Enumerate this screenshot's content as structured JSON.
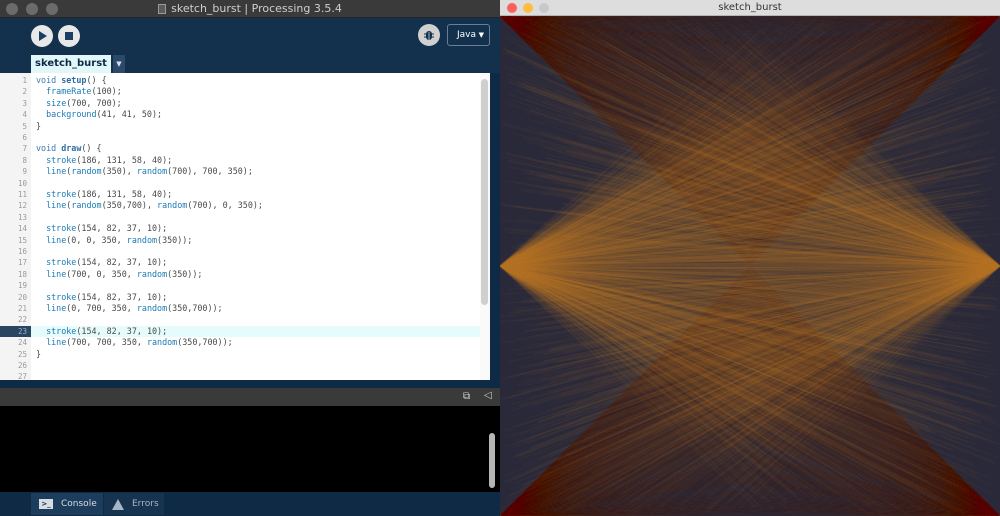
{
  "ide": {
    "window_title": "sketch_burst | Processing 3.5.4",
    "mode_label": "Java",
    "tab_label": "sketch_burst",
    "code_lines": [
      {
        "n": "1",
        "segs": [
          [
            "kw",
            "void "
          ],
          [
            "fn",
            "setup"
          ],
          [
            "",
            "() {"
          ]
        ]
      },
      {
        "n": "2",
        "segs": [
          [
            "",
            "  "
          ],
          [
            "call",
            "frameRate"
          ],
          [
            "",
            "(100);"
          ]
        ]
      },
      {
        "n": "3",
        "segs": [
          [
            "",
            "  "
          ],
          [
            "call",
            "size"
          ],
          [
            "",
            "(700, 700);"
          ]
        ]
      },
      {
        "n": "4",
        "segs": [
          [
            "",
            "  "
          ],
          [
            "call",
            "background"
          ],
          [
            "",
            "(41, 41, 50);"
          ]
        ]
      },
      {
        "n": "5",
        "segs": [
          [
            "",
            "}"
          ]
        ]
      },
      {
        "n": "6",
        "segs": []
      },
      {
        "n": "7",
        "segs": [
          [
            "kw",
            "void "
          ],
          [
            "fn",
            "draw"
          ],
          [
            "",
            "() {"
          ]
        ]
      },
      {
        "n": "8",
        "segs": [
          [
            "",
            "  "
          ],
          [
            "call",
            "stroke"
          ],
          [
            "",
            "(186, 131, 58, 40);"
          ]
        ]
      },
      {
        "n": "9",
        "segs": [
          [
            "",
            "  "
          ],
          [
            "call",
            "line"
          ],
          [
            "",
            "("
          ],
          [
            "call",
            "random"
          ],
          [
            "",
            "(350), "
          ],
          [
            "call",
            "random"
          ],
          [
            "",
            "(700), 700, 350);"
          ]
        ]
      },
      {
        "n": "10",
        "segs": []
      },
      {
        "n": "11",
        "segs": [
          [
            "",
            "  "
          ],
          [
            "call",
            "stroke"
          ],
          [
            "",
            "(186, 131, 58, 40);"
          ]
        ]
      },
      {
        "n": "12",
        "segs": [
          [
            "",
            "  "
          ],
          [
            "call",
            "line"
          ],
          [
            "",
            "("
          ],
          [
            "call",
            "random"
          ],
          [
            "",
            "(350,700), "
          ],
          [
            "call",
            "random"
          ],
          [
            "",
            "(700), 0, 350);"
          ]
        ]
      },
      {
        "n": "13",
        "segs": []
      },
      {
        "n": "14",
        "segs": [
          [
            "",
            "  "
          ],
          [
            "call",
            "stroke"
          ],
          [
            "",
            "(154, 82, 37, 10);"
          ]
        ]
      },
      {
        "n": "15",
        "segs": [
          [
            "",
            "  "
          ],
          [
            "call",
            "line"
          ],
          [
            "",
            "(0, 0, 350, "
          ],
          [
            "call",
            "random"
          ],
          [
            "",
            "(350));"
          ]
        ]
      },
      {
        "n": "16",
        "segs": []
      },
      {
        "n": "17",
        "segs": [
          [
            "",
            "  "
          ],
          [
            "call",
            "stroke"
          ],
          [
            "",
            "(154, 82, 37, 10);"
          ]
        ]
      },
      {
        "n": "18",
        "segs": [
          [
            "",
            "  "
          ],
          [
            "call",
            "line"
          ],
          [
            "",
            "(700, 0, 350, "
          ],
          [
            "call",
            "random"
          ],
          [
            "",
            "(350));"
          ]
        ]
      },
      {
        "n": "19",
        "segs": []
      },
      {
        "n": "20",
        "segs": [
          [
            "",
            "  "
          ],
          [
            "call",
            "stroke"
          ],
          [
            "",
            "(154, 82, 37, 10);"
          ]
        ]
      },
      {
        "n": "21",
        "segs": [
          [
            "",
            "  "
          ],
          [
            "call",
            "line"
          ],
          [
            "",
            "(0, 700, 350, "
          ],
          [
            "call",
            "random"
          ],
          [
            "",
            "(350,700));"
          ]
        ]
      },
      {
        "n": "22",
        "segs": []
      },
      {
        "n": "23",
        "segs": [
          [
            "",
            "  "
          ],
          [
            "call",
            "stroke"
          ],
          [
            "",
            "(154, 82, 37, 10);"
          ]
        ],
        "hl": true
      },
      {
        "n": "24",
        "segs": [
          [
            "",
            "  "
          ],
          [
            "call",
            "line"
          ],
          [
            "",
            "(700, 700, 350, "
          ],
          [
            "call",
            "random"
          ],
          [
            "",
            "(350,700));"
          ]
        ]
      },
      {
        "n": "25",
        "segs": [
          [
            "",
            "}"
          ]
        ]
      },
      {
        "n": "26",
        "segs": []
      },
      {
        "n": "27",
        "segs": []
      }
    ],
    "console_tab": "Console",
    "errors_tab": "Errors"
  },
  "sketch": {
    "window_title": "sketch_burst",
    "background": "#29293a",
    "stroke_main": "#ba833a",
    "stroke_faint": "#9a5225"
  }
}
